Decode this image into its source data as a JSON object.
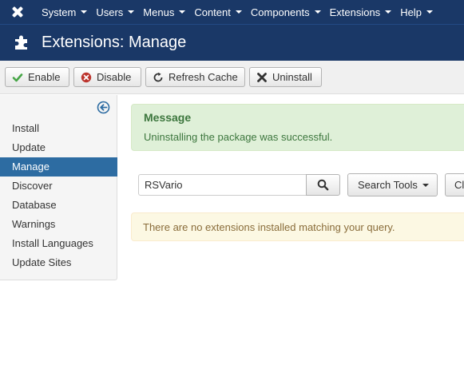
{
  "nav": {
    "items": [
      {
        "label": "System"
      },
      {
        "label": "Users"
      },
      {
        "label": "Menus"
      },
      {
        "label": "Content"
      },
      {
        "label": "Components"
      },
      {
        "label": "Extensions"
      },
      {
        "label": "Help"
      }
    ]
  },
  "header": {
    "title": "Extensions: Manage"
  },
  "toolbar": {
    "enable_label": "Enable",
    "disable_label": "Disable",
    "refresh_label": "Refresh Cache",
    "uninstall_label": "Uninstall"
  },
  "sidebar": {
    "items": [
      {
        "label": "Install"
      },
      {
        "label": "Update"
      },
      {
        "label": "Manage",
        "active": true
      },
      {
        "label": "Discover"
      },
      {
        "label": "Database"
      },
      {
        "label": "Warnings"
      },
      {
        "label": "Install Languages"
      },
      {
        "label": "Update Sites"
      }
    ]
  },
  "message": {
    "heading": "Message",
    "text": "Uninstalling the package was successful."
  },
  "search": {
    "value": "RSVario",
    "tools_label": "Search Tools",
    "clear_label": "Clear"
  },
  "notice": {
    "text": "There are no extensions installed matching your query."
  },
  "colors": {
    "navbar": "#1a3867",
    "active_item": "#2d6ca2",
    "success_bg": "#dff0d8",
    "warning_bg": "#fcf8e3"
  }
}
